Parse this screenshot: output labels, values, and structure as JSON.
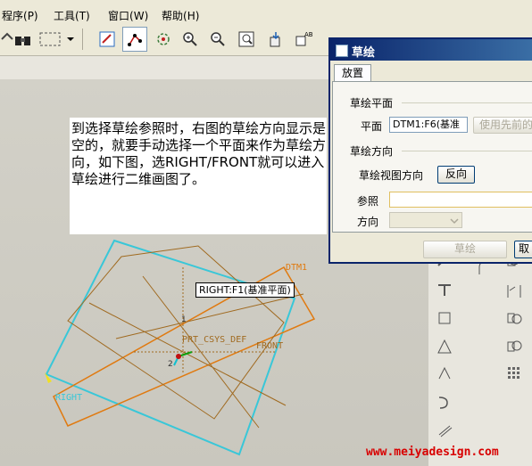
{
  "menubar": {
    "items": [
      {
        "label": "程序",
        "key": "(P)"
      },
      {
        "label": "工具",
        "key": "(T)"
      },
      {
        "label": "窗口",
        "key": "(W)"
      },
      {
        "label": "帮助",
        "key": "(H)"
      }
    ]
  },
  "note": {
    "text": "到选择草绘参照时，右图的草绘方向显示是空的，就要手动选择一个平面来作为草绘方向，如下图，选RIGHT/FRONT就可以进入草绘进行二维画图了。"
  },
  "viewport": {
    "tooltip": "RIGHT:F1(基准平面)",
    "labels": {
      "dtm1": "DTM1",
      "right": "RIGHT",
      "front": "FRONT",
      "csys": "PRT_CSYS_DEF",
      "axis_1": "1",
      "axis_2": "2"
    }
  },
  "dialog": {
    "title": "草绘",
    "tab": "放置",
    "section_plane": "草绘平面",
    "plane_label": "平面",
    "plane_value": "DTM1:F6(基准",
    "use_previous_label": "使用先前的",
    "section_direction": "草绘方向",
    "view_direction_label": "草绘视图方向",
    "flip_button": "反向",
    "reference_label": "参照",
    "reference_value": "",
    "orientation_label": "方向",
    "orientation_value": "",
    "sketch_button": "草绘",
    "cancel_button": "取"
  },
  "watermark": "www.meiyadesign.com",
  "colors": {
    "cyan_plane": "#39c7d8",
    "orange_plane": "#e07a10",
    "brown_plane": "#a06a20",
    "title_dark": "#0a246a",
    "watermark": "#d80000"
  }
}
